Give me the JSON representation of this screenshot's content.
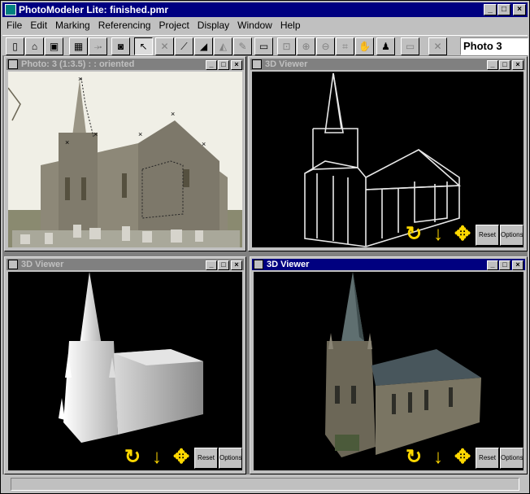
{
  "app": {
    "title": "PhotoModeler Lite: finished.pmr",
    "min": "_",
    "max": "□",
    "close": "×"
  },
  "menu": [
    {
      "label": "File"
    },
    {
      "label": "Edit"
    },
    {
      "label": "Marking"
    },
    {
      "label": "Referencing"
    },
    {
      "label": "Project"
    },
    {
      "label": "Display"
    },
    {
      "label": "Window"
    },
    {
      "label": "Help"
    }
  ],
  "toolbar": {
    "photo_select": "Photo 3"
  },
  "windows": {
    "photo": {
      "title": "Photo: 3 (1:3.5) :  : oriented"
    },
    "viewer_wire": {
      "title": "3D Viewer",
      "reset": "Reset",
      "options": "Options"
    },
    "viewer_shaded": {
      "title": "3D Viewer",
      "reset": "Reset",
      "options": "Options"
    },
    "viewer_texture": {
      "title": "3D Viewer",
      "reset": "Reset",
      "options": "Options"
    }
  }
}
